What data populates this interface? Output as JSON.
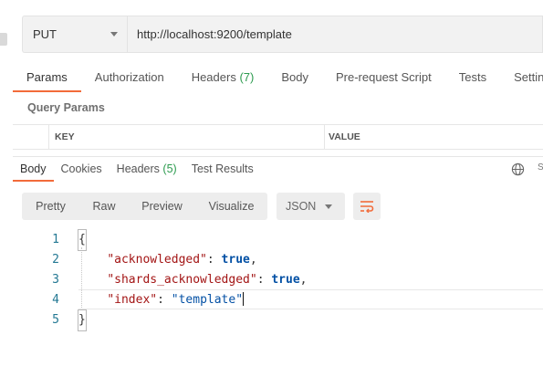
{
  "request": {
    "method": "PUT",
    "url": "http://localhost:9200/template"
  },
  "request_tabs": [
    {
      "label": "Params",
      "count": "",
      "active": true
    },
    {
      "label": "Authorization",
      "count": "",
      "active": false
    },
    {
      "label": "Headers",
      "count": "(7)",
      "active": false
    },
    {
      "label": "Body",
      "count": "",
      "active": false
    },
    {
      "label": "Pre-request Script",
      "count": "",
      "active": false
    },
    {
      "label": "Tests",
      "count": "",
      "active": false
    },
    {
      "label": "Setting",
      "count": "",
      "active": false
    }
  ],
  "query_params": {
    "title": "Query Params",
    "columns": [
      "KEY",
      "VALUE"
    ]
  },
  "response_tabs": [
    {
      "label": "Body",
      "count": "",
      "active": true
    },
    {
      "label": "Cookies",
      "count": "",
      "active": false
    },
    {
      "label": "Headers",
      "count": "(5)",
      "active": false
    },
    {
      "label": "Test Results",
      "count": "",
      "active": false
    }
  ],
  "response_extra": "S",
  "view_modes": [
    "Pretty",
    "Raw",
    "Preview",
    "Visualize"
  ],
  "format": "JSON",
  "code_lines": [
    {
      "num": "1",
      "text": "{"
    },
    {
      "num": "2",
      "key": "\"acknowledged\"",
      "sep": ": ",
      "value": "true",
      "value_type": "bool",
      "tail": ","
    },
    {
      "num": "3",
      "key": "\"shards_acknowledged\"",
      "sep": ": ",
      "value": "true",
      "value_type": "bool",
      "tail": ","
    },
    {
      "num": "4",
      "key": "\"index\"",
      "sep": ": ",
      "value": "\"template\"",
      "value_type": "str",
      "tail": ""
    },
    {
      "num": "5",
      "text": "}"
    }
  ],
  "colors": {
    "accent": "#f26b3a",
    "count_green": "#2d9b4f",
    "line_number": "#237893",
    "json_key": "#a31515",
    "json_value": "#0451a5"
  }
}
